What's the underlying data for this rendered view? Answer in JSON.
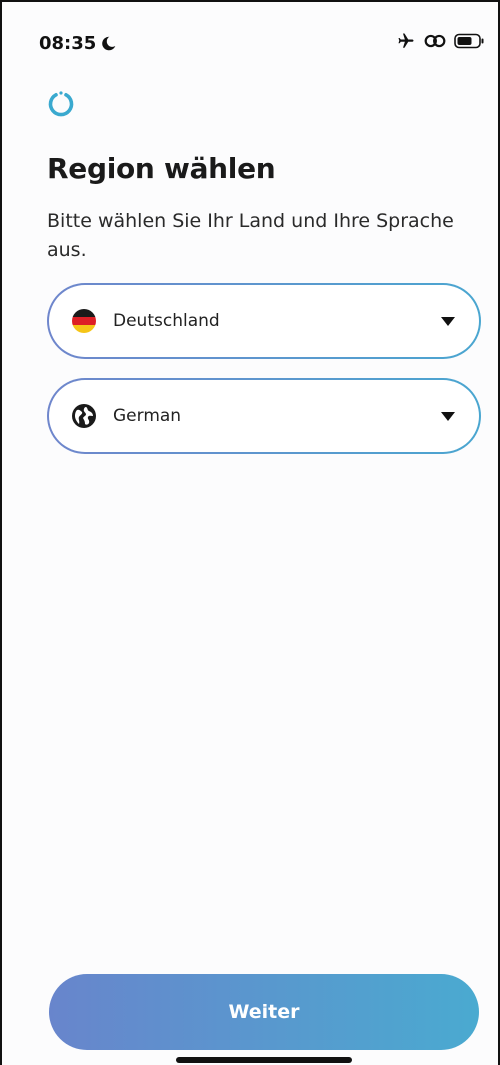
{
  "status_bar": {
    "time": "08:35",
    "icons": [
      "moon-icon",
      "airplane-icon",
      "link-icon",
      "battery-icon"
    ]
  },
  "logo_icon": "power-ring-icon",
  "page": {
    "title": "Region wählen",
    "subtitle": "Bitte wählen Sie Ihr Land und Ihre Sprache aus."
  },
  "country": {
    "value": "Deutschland",
    "icon": "germany-flag-icon"
  },
  "language": {
    "value": "German",
    "icon": "globe-icon"
  },
  "actions": {
    "continue_label": "Weiter"
  },
  "colors": {
    "accent_start": "#6885cc",
    "accent_end": "#4aaad0",
    "logo": "#3aa9cf"
  }
}
